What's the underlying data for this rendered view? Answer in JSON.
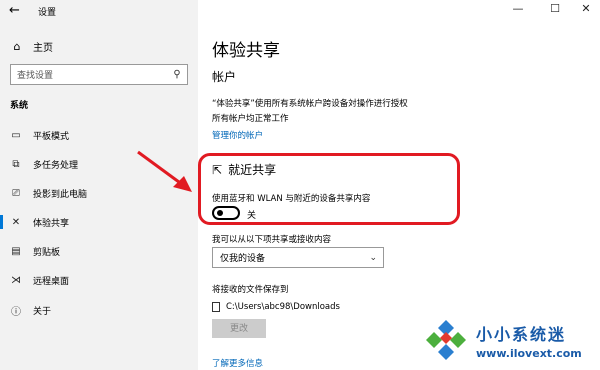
{
  "window": {
    "title": "设置",
    "back_icon": "←",
    "minimize": "—",
    "maximize": "☐",
    "close": "✕"
  },
  "sidebar": {
    "home_label": "主页",
    "search_placeholder": "查找设置",
    "section_label": "系统",
    "items": [
      {
        "label": "平板模式",
        "icon": "tablet-icon",
        "active": false
      },
      {
        "label": "多任务处理",
        "icon": "multitask-icon",
        "active": false
      },
      {
        "label": "投影到此电脑",
        "icon": "project-icon",
        "active": false
      },
      {
        "label": "体验共享",
        "icon": "shared-experiences-icon",
        "active": true
      },
      {
        "label": "剪贴板",
        "icon": "clipboard-icon",
        "active": false
      },
      {
        "label": "远程桌面",
        "icon": "remote-desktop-icon",
        "active": false
      },
      {
        "label": "关于",
        "icon": "info-icon",
        "active": false
      }
    ]
  },
  "main": {
    "title": "体验共享",
    "account_heading": "帐户",
    "account_desc_1": "“体验共享”使用所有系统帐户跨设备対操作进行授权",
    "account_desc_2": "所有帐户均正常工作",
    "manage_link": "管理你的帐户",
    "nearby": {
      "title": "就近共享",
      "desc": "使用蓝牙和 WLAN 与附近的设备共享内容",
      "toggle_state": "关"
    },
    "share_label": "我可以从以下项共享或接收内容",
    "share_selected": "仅我的设备",
    "save_label": "将接收的文件保存到",
    "save_path": "C:\\Users\\abc98\\Downloads",
    "change_button": "更改",
    "more_link": "了解更多信息"
  },
  "watermark": {
    "name": "小小系统迷",
    "url": "www.ilovext.com"
  },
  "colors": {
    "accent": "#0078d7",
    "link": "#0067b8",
    "highlight": "#e11a22",
    "sidebar_bg": "#f2f2f2"
  }
}
